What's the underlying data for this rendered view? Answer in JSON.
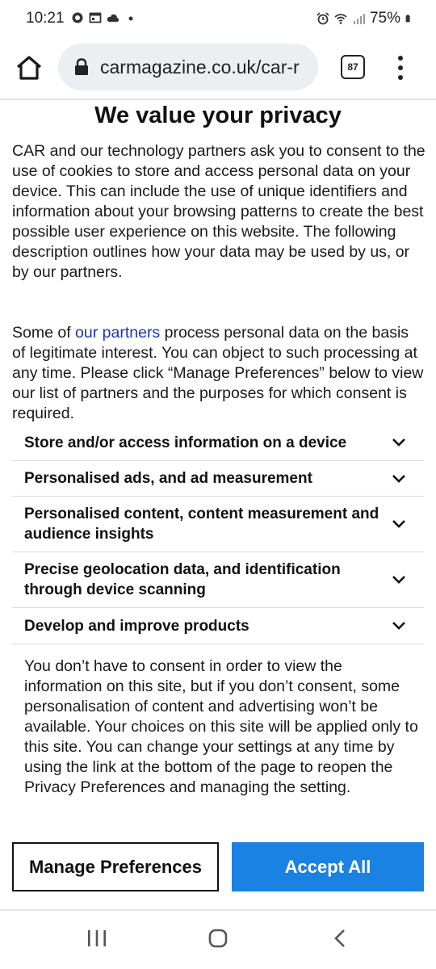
{
  "status_bar": {
    "time": "10:21",
    "battery": "75%",
    "left_icons": [
      "chat-bubble-icon",
      "calendar-icon",
      "cloud-icon",
      "dot-icon"
    ],
    "right_icons": [
      "alarm-icon",
      "wifi-icon",
      "signal-icon",
      "battery-icon"
    ]
  },
  "browser": {
    "url": "carmagazine.co.uk/car-r",
    "tab_count": "87"
  },
  "dialog": {
    "title": "We value your privacy",
    "intro": "CAR and our technology partners ask you to consent to the use of cookies to store and access personal data on your device. This can include the use of unique identifiers and information about your browsing patterns to create the best possible user experience on this website. The following description outlines how your data may be used by us, or by our partners.",
    "partners_prefix": "Some of ",
    "partners_link": "our partners",
    "partners_suffix": " process personal data on the basis of legitimate interest. You can object to such processing at any time. Please click “Manage Preferences” below to view our list of partners and the purposes for which consent is required.",
    "purposes": [
      "Store and/or access information on a device",
      "Personalised ads, and ad measurement",
      "Personalised content, content measurement and audience insights",
      "Precise geolocation data, and identification through device scanning",
      "Develop and improve products"
    ],
    "notice": "You don’t have to consent in order to view the information on this site, but if you don’t consent, some personalisation of content and advertising won’t be available. Your choices on this site will be applied only to this site. You can change your settings at any time by using the link at the bottom of the page to reopen the Privacy Preferences and managing the setting.",
    "manage_label": "Manage Preferences",
    "accept_label": "Accept All"
  },
  "colors": {
    "accent": "#1a82e2",
    "link": "#1a36b6",
    "url_bar": "#eceff1"
  }
}
